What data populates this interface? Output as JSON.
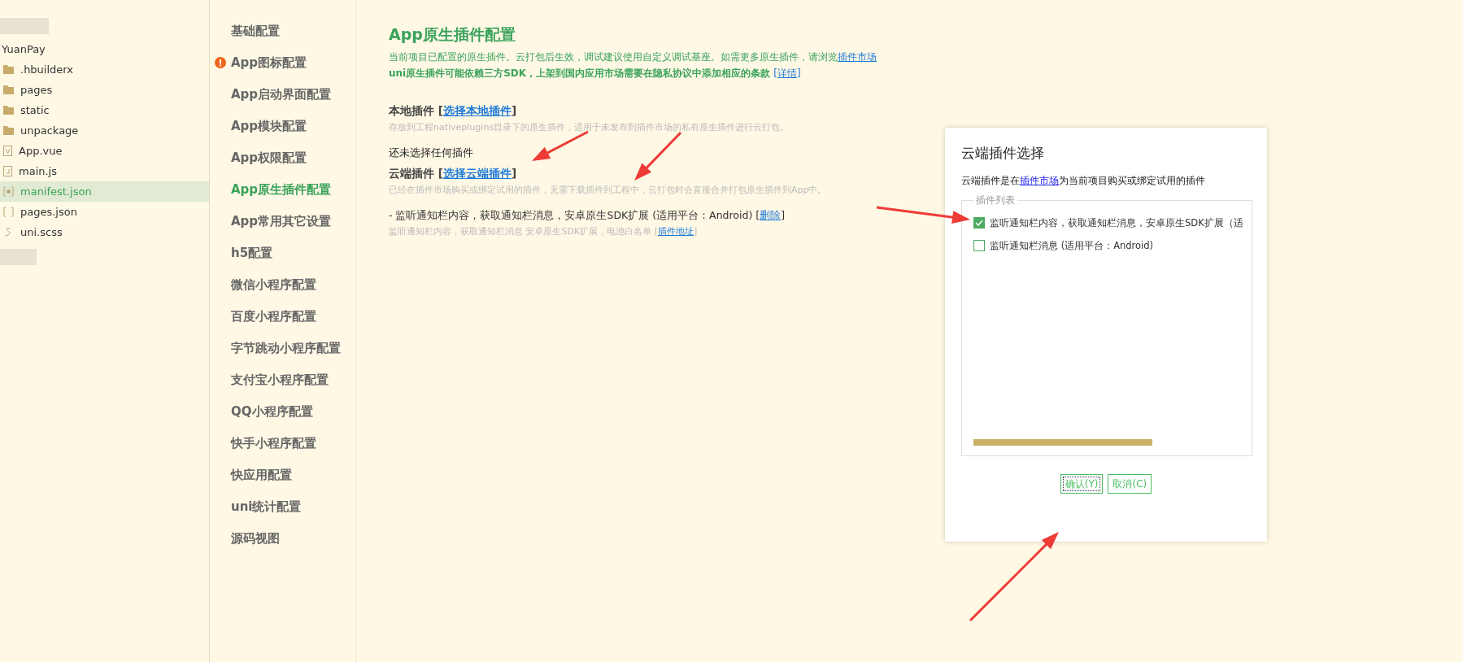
{
  "file_tree": {
    "project": "YuanPay",
    "items": [
      {
        "name": ".hbuilderx",
        "kind": "folder",
        "selected": false
      },
      {
        "name": "pages",
        "kind": "folder",
        "selected": false
      },
      {
        "name": "static",
        "kind": "folder",
        "selected": false
      },
      {
        "name": "unpackage",
        "kind": "folder",
        "selected": false
      },
      {
        "name": "App.vue",
        "kind": "vue",
        "selected": false
      },
      {
        "name": "main.js",
        "kind": "js",
        "selected": false
      },
      {
        "name": "manifest.json",
        "kind": "manifest",
        "selected": true
      },
      {
        "name": "pages.json",
        "kind": "json",
        "selected": false
      },
      {
        "name": "uni.scss",
        "kind": "scss",
        "selected": false
      }
    ]
  },
  "settings_nav": [
    {
      "label": "基础配置",
      "selected": false,
      "warning": false
    },
    {
      "label": "App图标配置",
      "selected": false,
      "warning": true
    },
    {
      "label": "App启动界面配置",
      "selected": false,
      "warning": false
    },
    {
      "label": "App模块配置",
      "selected": false,
      "warning": false
    },
    {
      "label": "App权限配置",
      "selected": false,
      "warning": false
    },
    {
      "label": "App原生插件配置",
      "selected": true,
      "warning": false
    },
    {
      "label": "App常用其它设置",
      "selected": false,
      "warning": false
    },
    {
      "label": "h5配置",
      "selected": false,
      "warning": false
    },
    {
      "label": "微信小程序配置",
      "selected": false,
      "warning": false
    },
    {
      "label": "百度小程序配置",
      "selected": false,
      "warning": false
    },
    {
      "label": "字节跳动小程序配置",
      "selected": false,
      "warning": false
    },
    {
      "label": "支付宝小程序配置",
      "selected": false,
      "warning": false
    },
    {
      "label": "QQ小程序配置",
      "selected": false,
      "warning": false
    },
    {
      "label": "快手小程序配置",
      "selected": false,
      "warning": false
    },
    {
      "label": "快应用配置",
      "selected": false,
      "warning": false
    },
    {
      "label": "uni统计配置",
      "selected": false,
      "warning": false
    },
    {
      "label": "源码视图",
      "selected": false,
      "warning": false
    }
  ],
  "content": {
    "title": "App原生插件配置",
    "intro": "当前项目已配置的原生插件。云打包后生效，调试建议使用自定义调试基座。如需更多原生插件，请浏览",
    "intro_link": "插件市场",
    "notice": "uni原生插件可能依赖三方SDK，上架到国内应用市场需要在隐私协议中添加相应的条款",
    "notice_link": "[详情]",
    "local": {
      "heading": "本地插件 [",
      "link": "选择本地插件",
      "link_close": "]",
      "hint": "存放到工程nativeplugins目录下的原生插件，适用于未发布到插件市场的私有原生插件进行云打包。",
      "empty": "还未选择任何插件"
    },
    "cloud": {
      "heading": "云端插件 [",
      "link": "选择云端插件",
      "link_close": "]",
      "hint": "已经在插件市场购买或绑定试用的插件，无需下载插件到工程中，云打包时会直接合并打包原生插件到App中。",
      "plugins": [
        {
          "name": "- 监听通知栏内容，获取通知栏消息，安卓原生SDK扩展 (适用平台：Android) [",
          "remove": "删除",
          "remove_close": "]",
          "desc": "监听通知栏内容，获取通知栏消息 安卓原生SDK扩展，电池白名单 [",
          "link": "插件地址",
          "link_close": "]"
        }
      ]
    }
  },
  "dialog": {
    "title": "云端插件选择",
    "desc_before": "云端插件是在",
    "desc_link": "插件市场",
    "desc_after": "为当前项目购买或绑定试用的插件",
    "legend": "插件列表",
    "items": [
      {
        "label": "监听通知栏内容，获取通知栏消息，安卓原生SDK扩展（适",
        "checked": true
      },
      {
        "label": "监听通知栏消息 (适用平台：Android)",
        "checked": false
      }
    ],
    "buttons": [
      "确认(Y)",
      "取消(C)"
    ]
  }
}
